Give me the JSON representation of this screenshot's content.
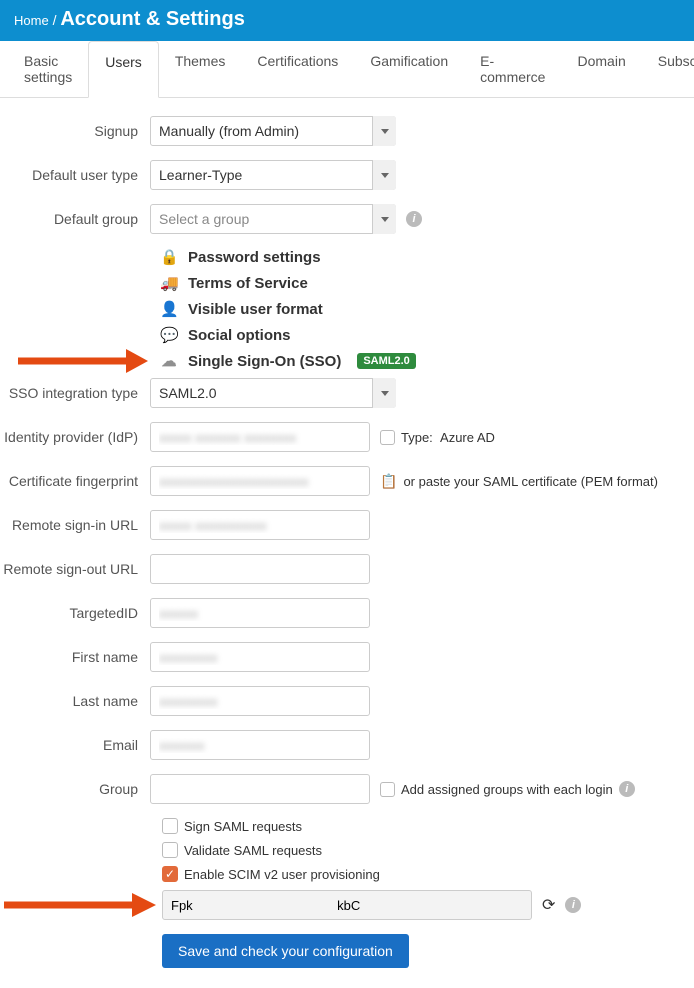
{
  "breadcrumb": {
    "home": "Home",
    "title": "Account & Settings"
  },
  "tabs": [
    "Basic settings",
    "Users",
    "Themes",
    "Certifications",
    "Gamification",
    "E-commerce",
    "Domain",
    "Subscri"
  ],
  "active_tab": 1,
  "form": {
    "signup": {
      "label": "Signup",
      "value": "Manually (from Admin)"
    },
    "default_user_type": {
      "label": "Default user type",
      "value": "Learner-Type"
    },
    "default_group": {
      "label": "Default group",
      "placeholder": "Select a group"
    }
  },
  "sections": {
    "password": "Password settings",
    "tos": "Terms of Service",
    "visible_user": "Visible user format",
    "social": "Social options",
    "sso": "Single Sign-On (SSO)",
    "sso_badge": "SAML2.0"
  },
  "sso": {
    "integration_type": {
      "label": "SSO integration type",
      "value": "SAML2.0"
    },
    "idp": {
      "label": "Identity provider (IdP)",
      "type_prefix": "Type:",
      "type_value": "Azure AD"
    },
    "fingerprint": {
      "label": "Certificate fingerprint",
      "aux": "or paste your SAML certificate (PEM format)"
    },
    "signin_url": {
      "label": "Remote sign-in URL"
    },
    "signout_url": {
      "label": "Remote sign-out URL"
    },
    "targeted_id": {
      "label": "TargetedID"
    },
    "first_name": {
      "label": "First name"
    },
    "last_name": {
      "label": "Last name"
    },
    "email": {
      "label": "Email"
    },
    "group": {
      "label": "Group",
      "aux": "Add assigned groups with each login"
    },
    "sign_requests": "Sign SAML requests",
    "validate_requests": "Validate SAML requests",
    "enable_scim": "Enable SCIM v2 user provisioning",
    "scim_token_prefix": "Fpk",
    "scim_token_suffix": "kbC"
  },
  "save_btn": "Save and check your configuration"
}
